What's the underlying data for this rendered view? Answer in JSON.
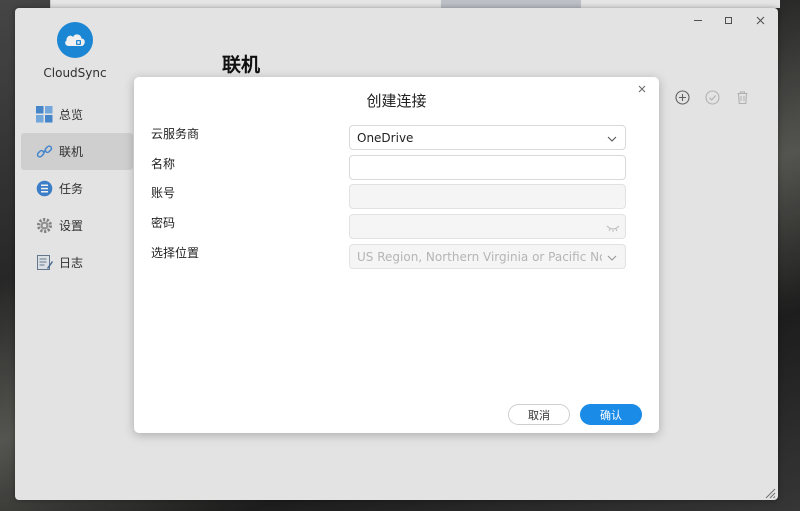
{
  "app": {
    "name": "CloudSync",
    "page_title": "联机",
    "window_controls": {
      "minimize_icon": "minimize-icon",
      "maximize_icon": "maximize-icon",
      "close_icon": "close-icon"
    }
  },
  "sidebar": {
    "items": [
      {
        "label": "总览",
        "icon": "dashboard-icon"
      },
      {
        "label": "联机",
        "icon": "link-icon",
        "active": true
      },
      {
        "label": "任务",
        "icon": "task-list-icon"
      },
      {
        "label": "设置",
        "icon": "gear-icon"
      },
      {
        "label": "日志",
        "icon": "log-icon"
      }
    ]
  },
  "toolbar": {
    "icons": [
      "add-icon",
      "check-icon",
      "trash-icon"
    ]
  },
  "dialog": {
    "title": "创建连接",
    "fields": {
      "provider": {
        "label": "云服务商",
        "value": "OneDrive"
      },
      "name": {
        "label": "名称",
        "value": ""
      },
      "account": {
        "label": "账号",
        "value": ""
      },
      "password": {
        "label": "密码",
        "value": ""
      },
      "location": {
        "label": "选择位置",
        "value": "US Region, Northern Virginia or Pacific Northv"
      }
    },
    "cancel_label": "取消",
    "ok_label": "确认"
  },
  "colors": {
    "accent": "#1a8be6",
    "logo": "#1d8fe1",
    "sidebar_active": "#dcdcdc"
  }
}
